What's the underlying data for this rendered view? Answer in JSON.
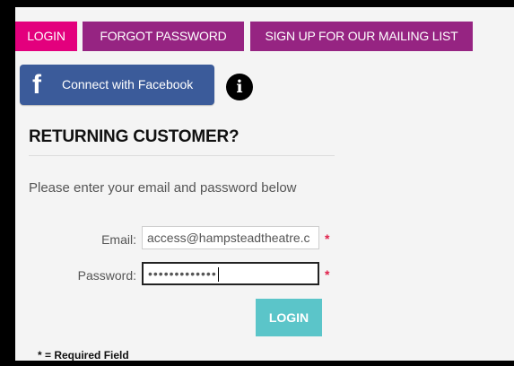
{
  "tabs": {
    "login": "LOGIN",
    "forgot_password": "FORGOT PASSWORD",
    "signup": "SIGN UP FOR OUR MAILING LIST"
  },
  "facebook": {
    "icon_glyph": "f",
    "label": "Connect with Facebook"
  },
  "info_icon": {
    "glyph": "i"
  },
  "section": {
    "title": "RETURNING CUSTOMER?",
    "intro": "Please enter your email and password below"
  },
  "form": {
    "email_label": "Email:",
    "email_value": "access@hampsteadtheatre.c",
    "password_label": "Password:",
    "password_value": "•••••••••••••",
    "required_marker": "*",
    "login_button": "LOGIN",
    "required_note": "* = Required Field"
  },
  "colors": {
    "tab_active": "#e3007d",
    "tab_inactive": "#962482",
    "facebook": "#3b5b9a",
    "login_button": "#5bc5c9",
    "required": "#e0204a"
  }
}
